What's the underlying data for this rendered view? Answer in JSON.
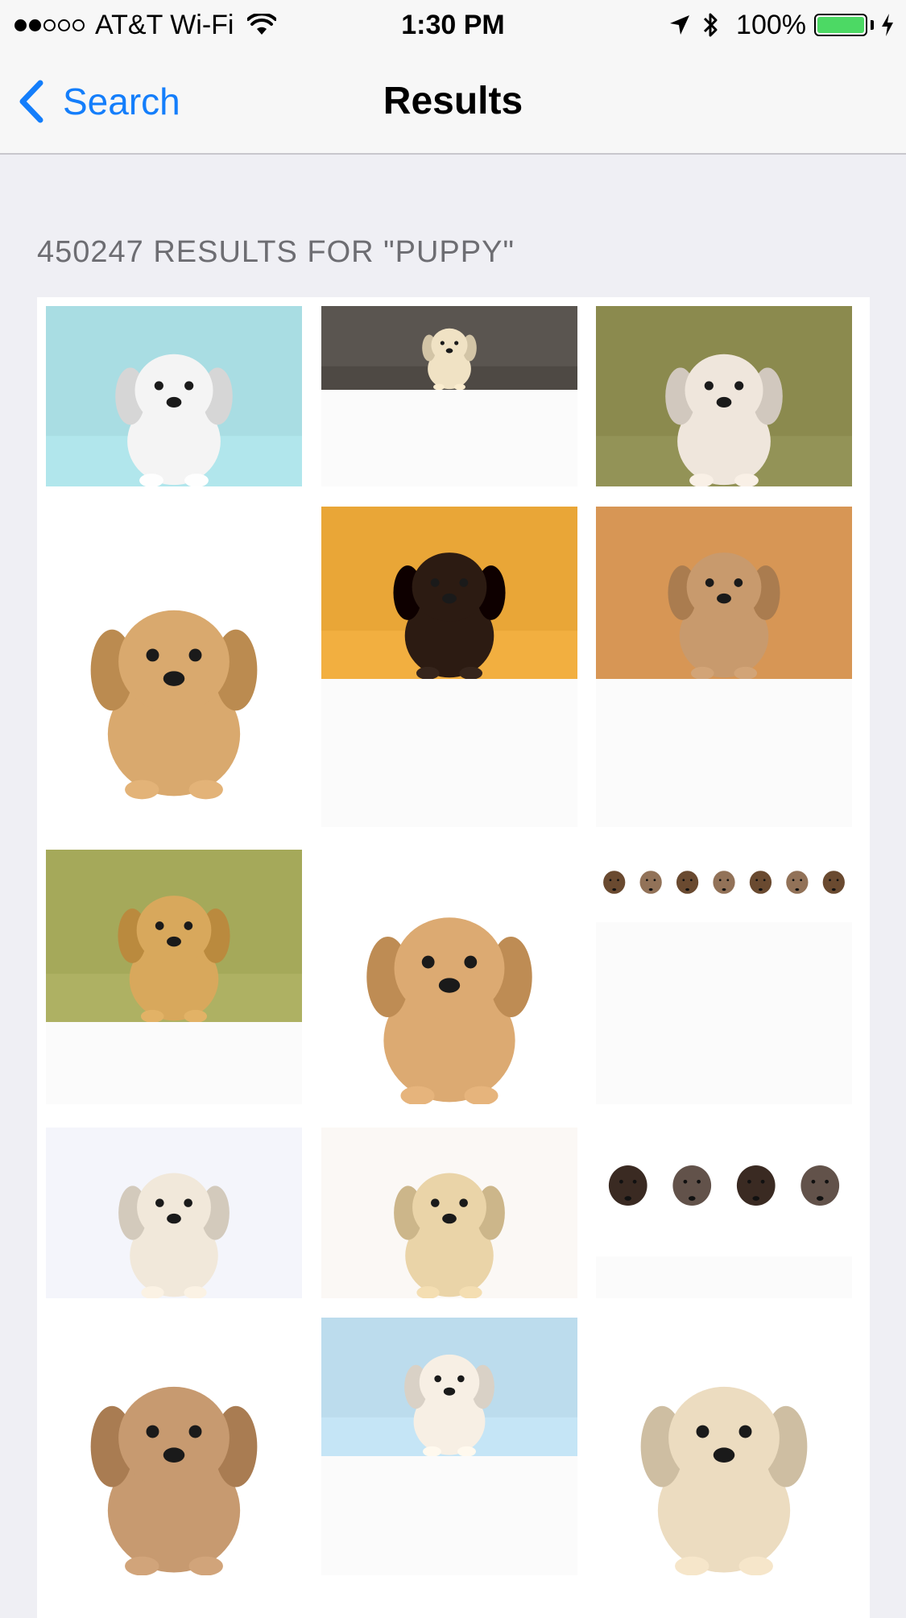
{
  "status_bar": {
    "carrier": "AT&T Wi-Fi",
    "time": "1:30 PM",
    "battery": "100%",
    "signal_bars_filled": 2,
    "signal_bars_total": 5,
    "icons": [
      "wifi-icon",
      "location-arrow-icon",
      "bluetooth-icon",
      "battery-icon",
      "charging-bolt-icon"
    ]
  },
  "nav": {
    "back_label": "Search",
    "title": "Results"
  },
  "results": {
    "header": "450247 RESULTS FOR \"PUPPY\""
  },
  "images": [
    {
      "name": "dalmatian-puppy-paint",
      "bg": "#a9dde3",
      "dog": "#f4f4f4"
    },
    {
      "name": "lab-puppy-tie",
      "bg": "#5a5550",
      "dog": "#f0e2c4"
    },
    {
      "name": "white-puppy-running-grass",
      "bg": "#8b8a4e",
      "dog": "#efe6dc"
    },
    {
      "name": "fluffy-tan-puppy",
      "bg": "#ffffff",
      "dog": "#d9a96e"
    },
    {
      "name": "rottweiler-puppy-leaves",
      "bg": "#e9a637",
      "dog": "#2c1b12"
    },
    {
      "name": "chihuahua-puppy-basket",
      "bg": "#d79655",
      "dog": "#c89a6d"
    },
    {
      "name": "golden-puppy-meadow",
      "bg": "#a5a95a",
      "dog": "#d8a85c"
    },
    {
      "name": "golden-puppy-walking",
      "bg": "#ffffff",
      "dog": "#dcaa72"
    },
    {
      "name": "row-of-puppies-kittens",
      "bg": "#ffffff",
      "dog": "#6a4a30"
    },
    {
      "name": "lab-puppy-sign",
      "bg": "#f4f5fb",
      "dog": "#f1e8da"
    },
    {
      "name": "lab-puppy-rope-toy",
      "bg": "#fbf8f5",
      "dog": "#ead4a8"
    },
    {
      "name": "four-puppies-row",
      "bg": "#ffffff",
      "dog": "#3a2a22"
    },
    {
      "name": "french-bulldog-puppy",
      "bg": "#ffffff",
      "dog": "#c79a70"
    },
    {
      "name": "white-puppy-blue-wall",
      "bg": "#bcdced",
      "dog": "#f7efe4"
    },
    {
      "name": "lab-puppy-waving",
      "bg": "#ffffff",
      "dog": "#ecdcc0"
    }
  ]
}
